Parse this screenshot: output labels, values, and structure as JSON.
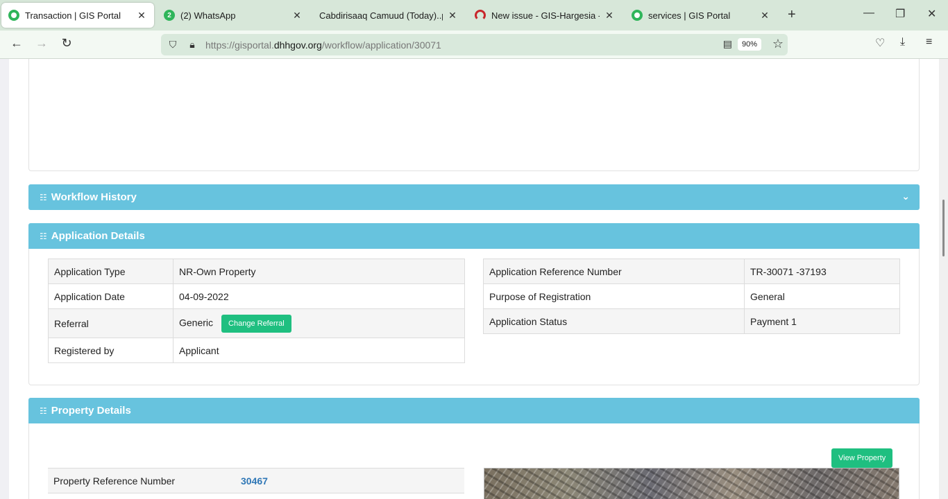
{
  "browser": {
    "tabs": [
      {
        "title": "Transaction | GIS Portal",
        "favicon": "gis-icon",
        "active": true
      },
      {
        "title": "(2) WhatsApp",
        "favicon": "whatsapp-icon",
        "badge": "2"
      },
      {
        "title": "Cabdirisaaq Camuud (Today)..pdf",
        "favicon": "pdf-icon"
      },
      {
        "title": "New issue - GIS-Hargesia - Team",
        "favicon": "azure-devops-icon"
      },
      {
        "title": "services | GIS Portal",
        "favicon": "gis-icon"
      }
    ],
    "url_prefix": "https://gisportal.",
    "url_domain": "dhhgov.org",
    "url_path": "/workflow/application/30071",
    "zoom": "90%"
  },
  "workflow_history": {
    "title": "Workflow History"
  },
  "application_details": {
    "title": "Application Details",
    "left_rows": [
      {
        "label": "Application Type",
        "value": "NR-Own Property"
      },
      {
        "label": "Application Date",
        "value": "04-09-2022"
      },
      {
        "label": "Referral",
        "value": "Generic",
        "button": "Change Referral"
      },
      {
        "label": "Registered by",
        "value": "Applicant"
      }
    ],
    "right_rows": [
      {
        "label": "Application Reference Number",
        "value": "TR-30071 -37193"
      },
      {
        "label": "Purpose of Registration",
        "value": "General"
      },
      {
        "label": "Application Status",
        "value": "Payment 1"
      }
    ]
  },
  "property_details": {
    "title": "Property Details",
    "view_button": "View Property",
    "rows": [
      {
        "label": "Property Reference Number",
        "value": "30467"
      }
    ]
  },
  "colors": {
    "panel_header": "#67c3de",
    "button_green": "#1fbf80",
    "link": "#2f77b6"
  }
}
